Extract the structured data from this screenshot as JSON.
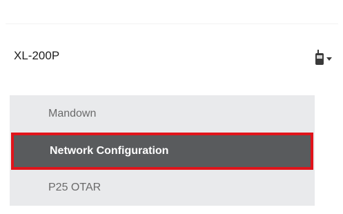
{
  "device": {
    "name": "XL-200P",
    "icon": "radio-icon"
  },
  "menu": {
    "items": [
      {
        "label": "Mandown",
        "selected": false
      },
      {
        "label": "Network Configuration",
        "selected": true
      },
      {
        "label": "P25 OTAR",
        "selected": false
      }
    ]
  },
  "colors": {
    "highlight_bg": "#595b5d",
    "highlight_border": "#e0141b",
    "menu_bg": "#e9eaec"
  }
}
